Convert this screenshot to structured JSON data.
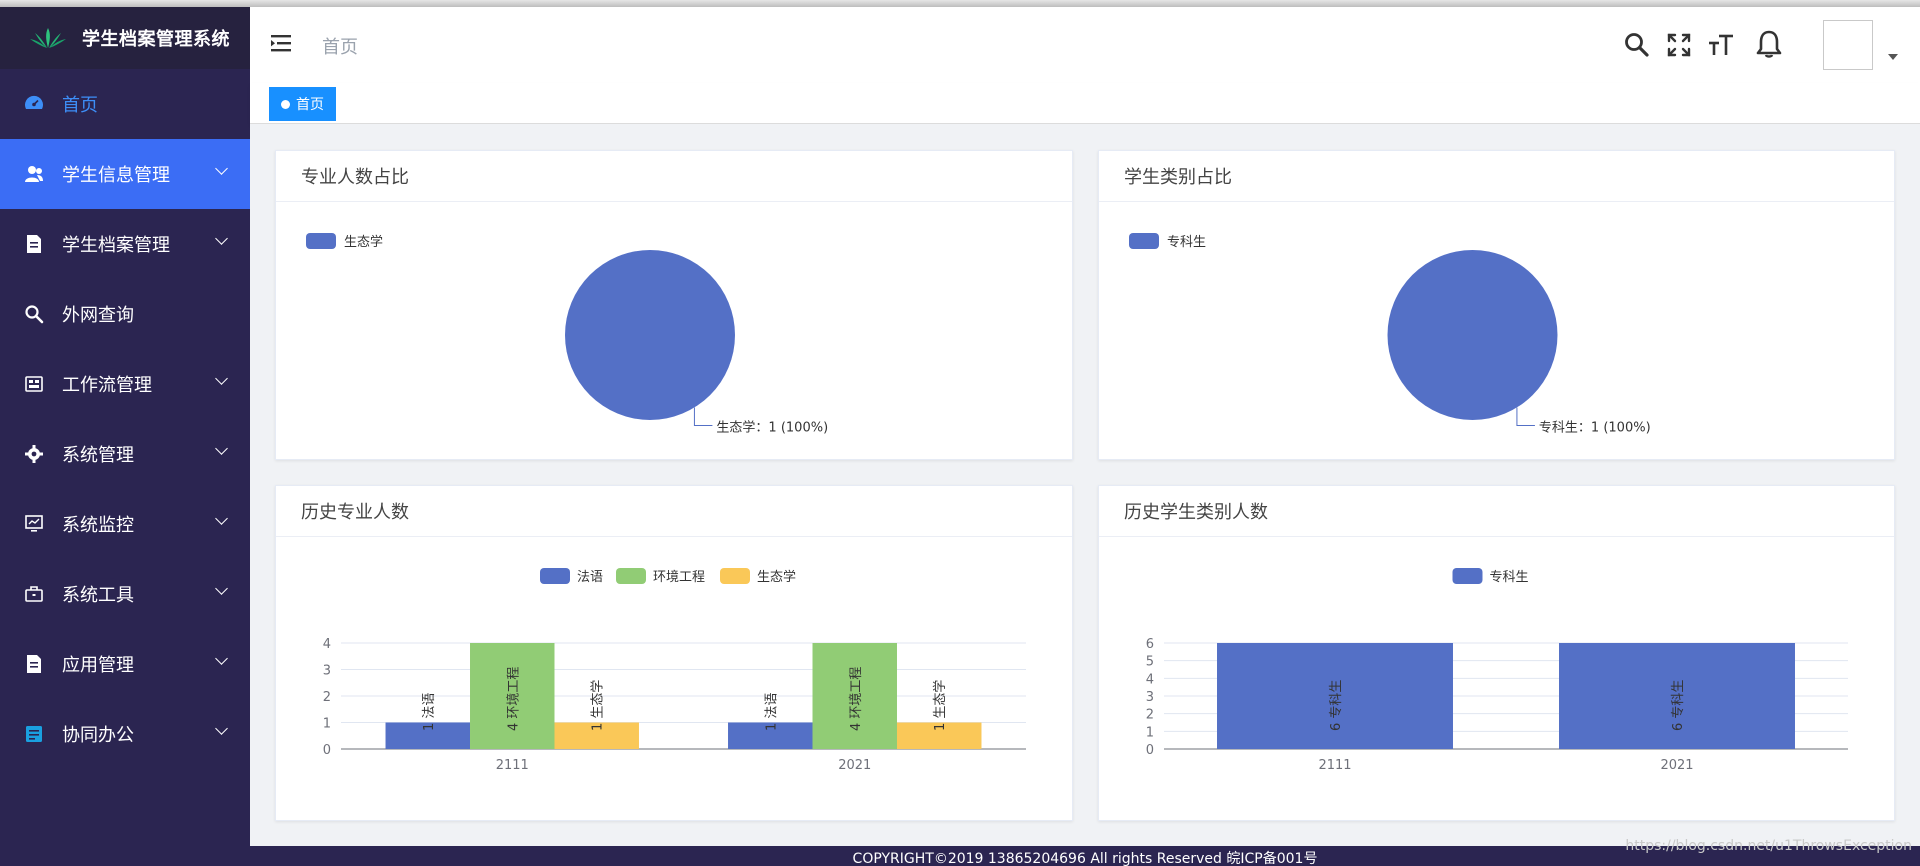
{
  "app": {
    "title": "学生档案管理系统"
  },
  "sidebar": {
    "items": [
      {
        "label": "首页",
        "icon": "dashboard-icon",
        "expandable": false
      },
      {
        "label": "学生信息管理",
        "icon": "user-icon",
        "expandable": true
      },
      {
        "label": "学生档案管理",
        "icon": "document-icon",
        "expandable": true
      },
      {
        "label": "外网查询",
        "icon": "search-icon",
        "expandable": false
      },
      {
        "label": "工作流管理",
        "icon": "workflow-icon",
        "expandable": true
      },
      {
        "label": "系统管理",
        "icon": "gear-icon",
        "expandable": true
      },
      {
        "label": "系统监控",
        "icon": "monitor-icon",
        "expandable": true
      },
      {
        "label": "系统工具",
        "icon": "toolbox-icon",
        "expandable": true
      },
      {
        "label": "应用管理",
        "icon": "document-icon",
        "expandable": true
      },
      {
        "label": "协同办公",
        "icon": "calendar-icon",
        "expandable": true
      }
    ]
  },
  "header": {
    "breadcrumb": "首页"
  },
  "tags": [
    {
      "label": "首页"
    }
  ],
  "cards": {
    "major_ratio": {
      "title": "专业人数占比"
    },
    "type_ratio": {
      "title": "学生类别占比"
    },
    "major_history": {
      "title": "历史专业人数"
    },
    "type_history": {
      "title": "历史学生类别人数"
    }
  },
  "colors": {
    "blue": "#5470c6",
    "green": "#91cc75",
    "yellow": "#fac858",
    "sidebar": "#2b2551",
    "active": "#3b6df5",
    "tag": "#1890ff"
  },
  "chart_data": [
    {
      "type": "pie",
      "labels": [
        "生态学"
      ],
      "values": [
        1
      ],
      "data_labels": [
        "生态学：1 (100%)"
      ],
      "legend": "top-left"
    },
    {
      "type": "pie",
      "labels": [
        "专科生"
      ],
      "values": [
        1
      ],
      "data_labels": [
        "专科生：1 (100%)"
      ],
      "legend": "top-left"
    },
    {
      "type": "bar",
      "categories": [
        "2111",
        "2021"
      ],
      "series": [
        {
          "name": "法语",
          "values": [
            1,
            1
          ]
        },
        {
          "name": "环境工程",
          "values": [
            4,
            4
          ]
        },
        {
          "name": "生态学",
          "values": [
            1,
            1
          ]
        }
      ],
      "ylim": [
        0,
        4
      ],
      "yticks": [
        "0",
        "1",
        "2",
        "3",
        "4"
      ],
      "legend": "top-center",
      "grid": true
    },
    {
      "type": "bar",
      "categories": [
        "2111",
        "2021"
      ],
      "series": [
        {
          "name": "专科生",
          "values": [
            6,
            6
          ]
        }
      ],
      "ylim": [
        0,
        6
      ],
      "yticks": [
        "0",
        "1",
        "2",
        "3",
        "4",
        "5",
        "6"
      ],
      "legend": "top-center",
      "grid": true
    }
  ],
  "footer": {
    "copyright": "COPYRIGHT©2019 13865204696 All rights Reserved 皖ICP备001号"
  },
  "watermark": "https://blog.csdn.net/u1ThrowsException"
}
